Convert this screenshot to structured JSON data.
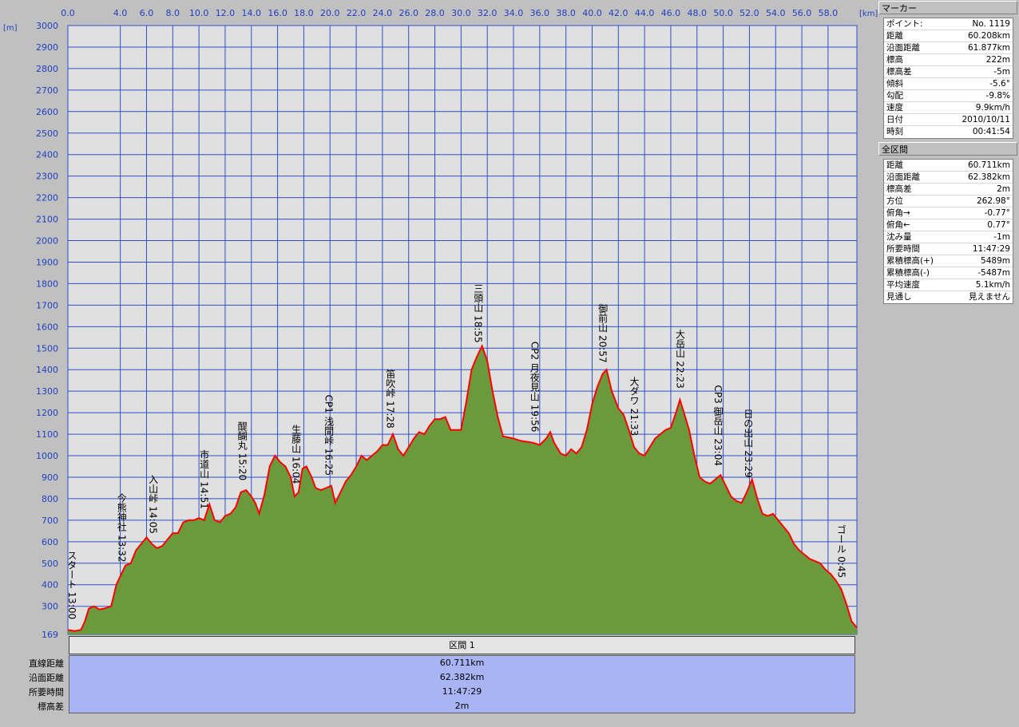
{
  "chart_data": {
    "type": "area",
    "x_unit": "[km]",
    "y_unit": "[m]",
    "x_ticks": [
      "0.0",
      "4.0",
      "6.0",
      "8.0",
      "10.0",
      "12.0",
      "14.0",
      "16.0",
      "18.0",
      "20.0",
      "22.0",
      "24.0",
      "26.0",
      "28.0",
      "30.0",
      "32.0",
      "34.0",
      "36.0",
      "38.0",
      "40.0",
      "42.0",
      "44.0",
      "46.0",
      "48.0",
      "50.0",
      "52.0",
      "54.0",
      "56.0",
      "58.0"
    ],
    "y_ticks": [
      "169",
      "300",
      "400",
      "500",
      "600",
      "700",
      "800",
      "900",
      "1000",
      "1100",
      "1200",
      "1300",
      "1400",
      "1500",
      "1600",
      "1700",
      "1800",
      "1900",
      "2000",
      "2100",
      "2200",
      "2300",
      "2400",
      "2500",
      "2600",
      "2700",
      "2800",
      "2900",
      "3000"
    ],
    "xlim": [
      0,
      60.2
    ],
    "ylim": [
      169,
      3000
    ],
    "fill_color": "#6b9a3c",
    "line_color": "#ff0000",
    "grid_color": "#3050c8",
    "plot_bg": "#e0e0e0",
    "grid": true,
    "profile": [
      [
        0,
        190
      ],
      [
        0.5,
        185
      ],
      [
        1.0,
        190
      ],
      [
        1.3,
        230
      ],
      [
        1.6,
        290
      ],
      [
        2.0,
        300
      ],
      [
        2.4,
        285
      ],
      [
        2.8,
        290
      ],
      [
        3.3,
        300
      ],
      [
        3.7,
        400
      ],
      [
        4.0,
        440
      ],
      [
        4.4,
        490
      ],
      [
        4.8,
        500
      ],
      [
        5.2,
        560
      ],
      [
        5.6,
        590
      ],
      [
        6.0,
        620
      ],
      [
        6.4,
        590
      ],
      [
        6.8,
        570
      ],
      [
        7.2,
        580
      ],
      [
        7.6,
        610
      ],
      [
        8.0,
        640
      ],
      [
        8.4,
        640
      ],
      [
        8.8,
        690
      ],
      [
        9.2,
        700
      ],
      [
        9.6,
        700
      ],
      [
        10.0,
        710
      ],
      [
        10.4,
        700
      ],
      [
        10.8,
        775
      ],
      [
        11.2,
        700
      ],
      [
        11.6,
        690
      ],
      [
        12.0,
        720
      ],
      [
        12.4,
        730
      ],
      [
        12.8,
        760
      ],
      [
        13.2,
        830
      ],
      [
        13.6,
        840
      ],
      [
        14.0,
        810
      ],
      [
        14.3,
        780
      ],
      [
        14.6,
        730
      ],
      [
        15.0,
        820
      ],
      [
        15.4,
        950
      ],
      [
        15.8,
        1000
      ],
      [
        16.2,
        970
      ],
      [
        16.6,
        950
      ],
      [
        17.0,
        900
      ],
      [
        17.3,
        810
      ],
      [
        17.6,
        830
      ],
      [
        17.9,
        940
      ],
      [
        18.2,
        950
      ],
      [
        18.6,
        900
      ],
      [
        18.9,
        850
      ],
      [
        19.3,
        840
      ],
      [
        19.7,
        850
      ],
      [
        20.1,
        860
      ],
      [
        20.4,
        780
      ],
      [
        20.8,
        830
      ],
      [
        21.2,
        880
      ],
      [
        21.6,
        910
      ],
      [
        22.0,
        950
      ],
      [
        22.4,
        1000
      ],
      [
        22.8,
        980
      ],
      [
        23.2,
        1000
      ],
      [
        23.6,
        1020
      ],
      [
        24.0,
        1050
      ],
      [
        24.4,
        1050
      ],
      [
        24.8,
        1100
      ],
      [
        25.2,
        1030
      ],
      [
        25.6,
        1000
      ],
      [
        26.0,
        1040
      ],
      [
        26.4,
        1080
      ],
      [
        26.8,
        1110
      ],
      [
        27.2,
        1100
      ],
      [
        27.6,
        1140
      ],
      [
        28.0,
        1170
      ],
      [
        28.4,
        1170
      ],
      [
        28.8,
        1180
      ],
      [
        29.2,
        1120
      ],
      [
        29.6,
        1120
      ],
      [
        30.0,
        1120
      ],
      [
        30.4,
        1250
      ],
      [
        30.8,
        1400
      ],
      [
        31.2,
        1460
      ],
      [
        31.6,
        1510
      ],
      [
        32.0,
        1440
      ],
      [
        32.4,
        1300
      ],
      [
        32.8,
        1180
      ],
      [
        33.2,
        1090
      ],
      [
        33.6,
        1085
      ],
      [
        34.0,
        1080
      ],
      [
        34.5,
        1070
      ],
      [
        35.0,
        1065
      ],
      [
        35.5,
        1060
      ],
      [
        36.0,
        1050
      ],
      [
        36.5,
        1080
      ],
      [
        36.8,
        1110
      ],
      [
        37.1,
        1060
      ],
      [
        37.6,
        1010
      ],
      [
        38.0,
        1000
      ],
      [
        38.4,
        1030
      ],
      [
        38.8,
        1010
      ],
      [
        39.2,
        1040
      ],
      [
        39.6,
        1120
      ],
      [
        40.0,
        1240
      ],
      [
        40.4,
        1320
      ],
      [
        40.8,
        1380
      ],
      [
        41.1,
        1400
      ],
      [
        41.5,
        1300
      ],
      [
        42.0,
        1220
      ],
      [
        42.4,
        1190
      ],
      [
        42.8,
        1120
      ],
      [
        43.2,
        1040
      ],
      [
        43.6,
        1010
      ],
      [
        44.0,
        1000
      ],
      [
        44.4,
        1040
      ],
      [
        44.8,
        1080
      ],
      [
        45.2,
        1100
      ],
      [
        45.6,
        1120
      ],
      [
        46.0,
        1130
      ],
      [
        46.4,
        1200
      ],
      [
        46.7,
        1260
      ],
      [
        47.0,
        1200
      ],
      [
        47.4,
        1120
      ],
      [
        47.8,
        1000
      ],
      [
        48.2,
        900
      ],
      [
        48.6,
        880
      ],
      [
        49.0,
        870
      ],
      [
        49.4,
        890
      ],
      [
        49.8,
        910
      ],
      [
        50.2,
        860
      ],
      [
        50.6,
        810
      ],
      [
        51.0,
        790
      ],
      [
        51.4,
        780
      ],
      [
        51.8,
        830
      ],
      [
        52.2,
        890
      ],
      [
        52.6,
        800
      ],
      [
        53.0,
        730
      ],
      [
        53.4,
        720
      ],
      [
        53.8,
        730
      ],
      [
        54.2,
        700
      ],
      [
        54.6,
        670
      ],
      [
        55.0,
        640
      ],
      [
        55.4,
        590
      ],
      [
        55.8,
        560
      ],
      [
        56.2,
        540
      ],
      [
        56.6,
        520
      ],
      [
        57.0,
        510
      ],
      [
        57.4,
        500
      ],
      [
        57.8,
        470
      ],
      [
        58.2,
        450
      ],
      [
        58.6,
        420
      ],
      [
        59.0,
        380
      ],
      [
        59.4,
        310
      ],
      [
        59.8,
        230
      ],
      [
        60.2,
        200
      ]
    ],
    "annotations": [
      {
        "x": 0.3,
        "text": "スタート 13:00"
      },
      {
        "x": 4.1,
        "text": "今熊神社 13:32"
      },
      {
        "x": 6.5,
        "text": "入山峠 14:05"
      },
      {
        "x": 10.4,
        "text": "市道山 14:51"
      },
      {
        "x": 13.3,
        "text": "醍醐丸 15:20"
      },
      {
        "x": 17.4,
        "text": "生藤山 16:04"
      },
      {
        "x": 19.9,
        "text": "CP1 浅間峠 16:25"
      },
      {
        "x": 24.6,
        "text": "笛吹峠 17:28"
      },
      {
        "x": 31.3,
        "text": "三頭山 18:55"
      },
      {
        "x": 35.6,
        "text": "CP2 月夜見山 19:56"
      },
      {
        "x": 40.8,
        "text": "御前山 20:57"
      },
      {
        "x": 43.2,
        "text": "大ダワ 21:33"
      },
      {
        "x": 46.7,
        "text": "大岳山 22:23"
      },
      {
        "x": 49.6,
        "text": "CP3 御岳山 23:04"
      },
      {
        "x": 51.9,
        "text": "日の出山 23:29"
      },
      {
        "x": 59.0,
        "text": "ゴール 0:45"
      }
    ]
  },
  "marker_panel": {
    "title": "マーカー",
    "rows": [
      {
        "label": "ポイント:",
        "value": "No. 1119"
      },
      {
        "label": "距離",
        "value": "60.208km"
      },
      {
        "label": "沿面距離",
        "value": "61.877km"
      },
      {
        "label": "標高",
        "value": "222m"
      },
      {
        "label": "標高差",
        "value": "-5m"
      },
      {
        "label": "傾斜",
        "value": "-5.6°"
      },
      {
        "label": "勾配",
        "value": "-9.8%"
      },
      {
        "label": "速度",
        "value": "9.9km/h"
      },
      {
        "label": "日付",
        "value": "2010/10/11"
      },
      {
        "label": "時刻",
        "value": "00:41:54"
      }
    ]
  },
  "total_panel": {
    "title": "全区間",
    "rows": [
      {
        "label": "距離",
        "value": "60.711km"
      },
      {
        "label": "沿面距離",
        "value": "62.382km"
      },
      {
        "label": "標高差",
        "value": "2m"
      },
      {
        "label": "方位",
        "value": "262.98°"
      },
      {
        "label": "俯角→",
        "value": "-0.77°"
      },
      {
        "label": "俯角←",
        "value": "0.77°"
      },
      {
        "label": "沈み量",
        "value": "-1m"
      },
      {
        "label": "所要時間",
        "value": "11:47:29"
      },
      {
        "label": "累積標高(+)",
        "value": "5489m"
      },
      {
        "label": "累積標高(-)",
        "value": "-5487m"
      },
      {
        "label": "平均速度",
        "value": "5.1km/h"
      },
      {
        "label": "見通し",
        "value": "見えません"
      }
    ]
  },
  "section": {
    "header": "区間 1",
    "labels": [
      "直線距離",
      "沿面距離",
      "所要時間",
      "標高差"
    ],
    "values": [
      "60.711km",
      "62.382km",
      "11:47:29",
      "2m"
    ]
  }
}
